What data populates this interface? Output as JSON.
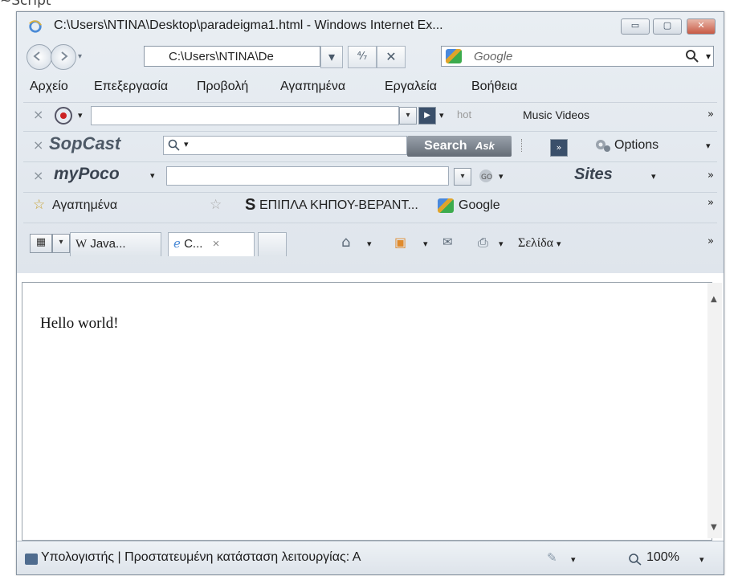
{
  "cropped_label": "~Script",
  "window": {
    "title": "C:\\Users\\NTINA\\Desktop\\paradeigma1.html - Windows Internet Ex...",
    "btn_minimize": "▭",
    "btn_maximize": "▢",
    "btn_close": "✕"
  },
  "address": {
    "value": "C:\\Users\\NTINA\\De",
    "dropdown": "▾",
    "refresh": "⁴⁄₇",
    "stop": "✕"
  },
  "search": {
    "placeholder": "Google",
    "icon": "search-icon"
  },
  "menu": {
    "items": [
      "Αρχείο",
      "Επεξεργασία",
      "Προβολή",
      "Αγαπημένα",
      "Εργαλεία",
      "Βοήθεια"
    ]
  },
  "toolbar1": {
    "close": "×",
    "music_label": "Music Videos",
    "hot_label": "hot",
    "more": "»"
  },
  "toolbar2": {
    "close": "×",
    "brand": "SopCast",
    "search_btn": "Search",
    "ask": "Ask",
    "options": "Options",
    "more": "▾"
  },
  "toolbar3": {
    "close": "×",
    "brand": "myPoco",
    "sites": "Sites",
    "more": "»"
  },
  "favorites": {
    "label": "Αγαπημένα",
    "s_letter": "S",
    "item1": "ΕΠΙΠΛΑ ΚΗΠΟΥ-ΒΕΡΑΝΤ...",
    "item2": "Google",
    "more": "»"
  },
  "tabs": {
    "tab1": "Java...",
    "tab2": "C...",
    "tab2_close": "×",
    "page_menu": "Σελίδα",
    "more": "»"
  },
  "content": {
    "text": "Hello world!"
  },
  "status": {
    "text": "Υπολογιστής | Προστατευμένη κατάσταση λειτουργίας: Α",
    "zoom": "100%",
    "dd": "▾"
  }
}
